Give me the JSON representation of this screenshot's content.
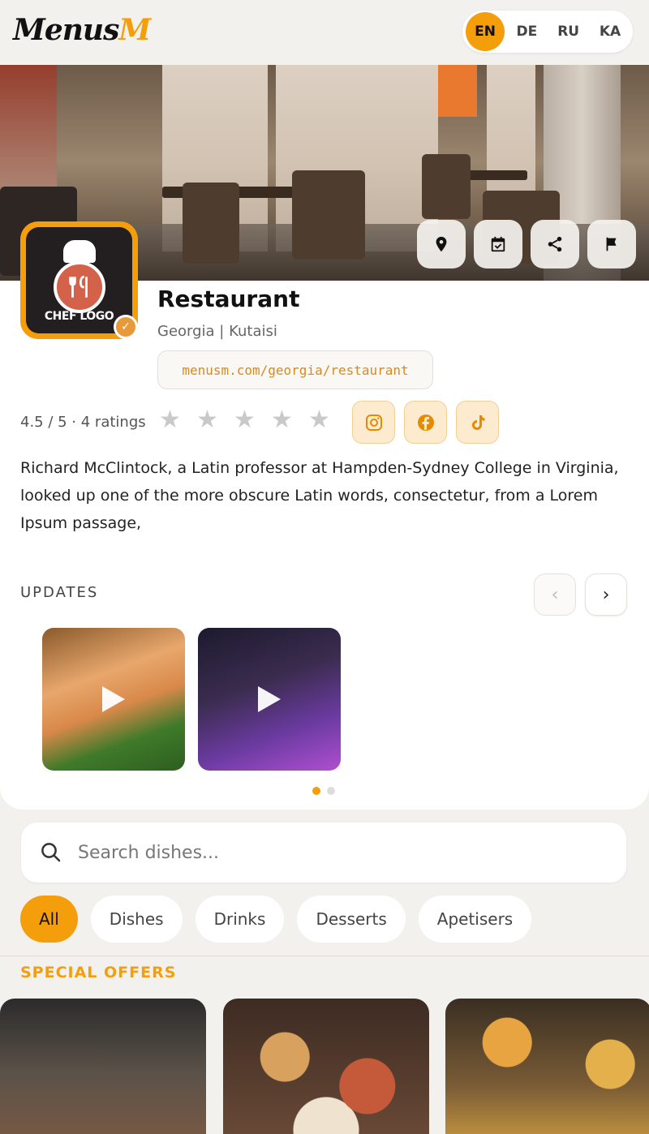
{
  "header": {
    "logo_part1": "MenusM",
    "languages": [
      {
        "code": "EN",
        "active": true
      },
      {
        "code": "DE",
        "active": false
      },
      {
        "code": "RU",
        "active": false
      },
      {
        "code": "KA",
        "active": false
      }
    ]
  },
  "hero": {
    "actions": [
      "map-pin-icon",
      "calendar-icon",
      "share-icon",
      "flag-icon"
    ]
  },
  "restaurant": {
    "logo_text": "CHEF LOGO",
    "name": "Restaurant",
    "location": "Georgia | Kutaisi",
    "url": "menusm.com/georgia/restaurant",
    "rating_text": "4.5 / 5 · 4 ratings",
    "stars_total": 5,
    "stars_filled": 0,
    "socials": [
      "instagram-icon",
      "facebook-icon",
      "tiktok-icon"
    ],
    "description": "Richard McClintock, a Latin professor at Hampden-Sydney College in Virginia, looked up one of the more obscure Latin words, consectetur, from a Lorem Ipsum passage,"
  },
  "updates": {
    "title": "UPDATES",
    "prev_icon": "‹",
    "next_icon": "›",
    "items": [
      {
        "type": "video"
      },
      {
        "type": "video"
      }
    ],
    "page": 1,
    "pages": 2
  },
  "search": {
    "placeholder": "Search dishes..."
  },
  "filters": {
    "items": [
      "All",
      "Dishes",
      "Drinks",
      "Desserts",
      "Apetisers"
    ],
    "active": "All"
  },
  "special_offers": {
    "title": "SPECIAL OFFERS"
  },
  "colors": {
    "accent": "#f59e0b",
    "background": "#f3f1ee",
    "card": "#ffffff"
  }
}
